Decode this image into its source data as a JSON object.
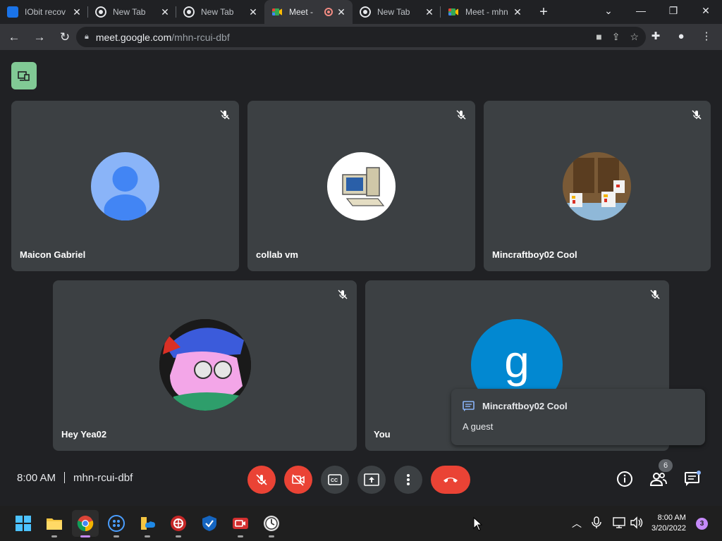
{
  "browser": {
    "tabs": [
      {
        "title": "IObit recov",
        "favicon_color": "#1a73e8",
        "active": false
      },
      {
        "title": "New Tab",
        "favicon_color": "#e8eaed",
        "active": false
      },
      {
        "title": "New Tab",
        "favicon_color": "#e8eaed",
        "active": false
      },
      {
        "title": "Meet - ",
        "favicon_color": "#34a853",
        "active": true
      },
      {
        "title": "New Tab",
        "favicon_color": "#e8eaed",
        "active": false
      },
      {
        "title": "Meet - mhn",
        "favicon_color": "#34a853",
        "active": false
      }
    ],
    "url_host": "meet.google.com",
    "url_path": "/mhn-rcui-dbf"
  },
  "meet": {
    "participants": [
      {
        "name": "Maicon Gabriel",
        "muted": true,
        "avatar": "default-person"
      },
      {
        "name": "collab vm",
        "muted": true,
        "avatar": "computer"
      },
      {
        "name": "Mincraftboy02 Cool",
        "muted": true,
        "avatar": "minecraft-chickens"
      },
      {
        "name": "Hey Yea02",
        "muted": true,
        "avatar": "cartoon-character"
      },
      {
        "name": "You",
        "muted": true,
        "avatar": "letter",
        "avatar_letter": "g",
        "avatar_color": "#0288d1"
      }
    ],
    "toast": {
      "sender": "Mincraftboy02 Cool",
      "message": "A guest"
    },
    "time": "8:00 AM",
    "meeting_code": "mhn-rcui-dbf",
    "participant_count": "6",
    "controls": [
      "mic-off",
      "camera-off",
      "captions",
      "present-screen",
      "more-options",
      "leave-call"
    ],
    "colors": {
      "accent_red": "#ea4335",
      "tile": "#3c4043",
      "background": "#202124"
    }
  },
  "taskbar": {
    "apps": [
      "start",
      "file-explorer",
      "chrome",
      "app-dots",
      "onedrive-folder",
      "iobit-app",
      "shield-app",
      "video-recorder",
      "clock-app"
    ],
    "time": "8:00 AM",
    "date": "3/20/2022",
    "notification_count": "3"
  }
}
